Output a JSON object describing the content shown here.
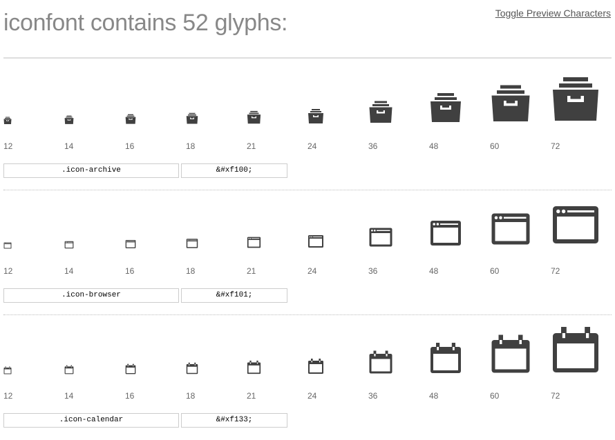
{
  "header": {
    "title": "iconfont contains 52 glyphs:",
    "toggle_label": "Toggle Preview Characters"
  },
  "sizes": [
    "12",
    "14",
    "16",
    "18",
    "21",
    "24",
    "36",
    "48",
    "60",
    "72"
  ],
  "glyphs": [
    {
      "icon": "archive-icon",
      "class_name": ".icon-archive",
      "entity": "&#xf100;"
    },
    {
      "icon": "browser-icon",
      "class_name": ".icon-browser",
      "entity": "&#xf101;"
    },
    {
      "icon": "calendar-icon",
      "class_name": ".icon-calendar",
      "entity": "&#xf133;"
    }
  ],
  "colors": {
    "glyph": "#404040",
    "title": "#888888",
    "rule": "#dddddd"
  }
}
